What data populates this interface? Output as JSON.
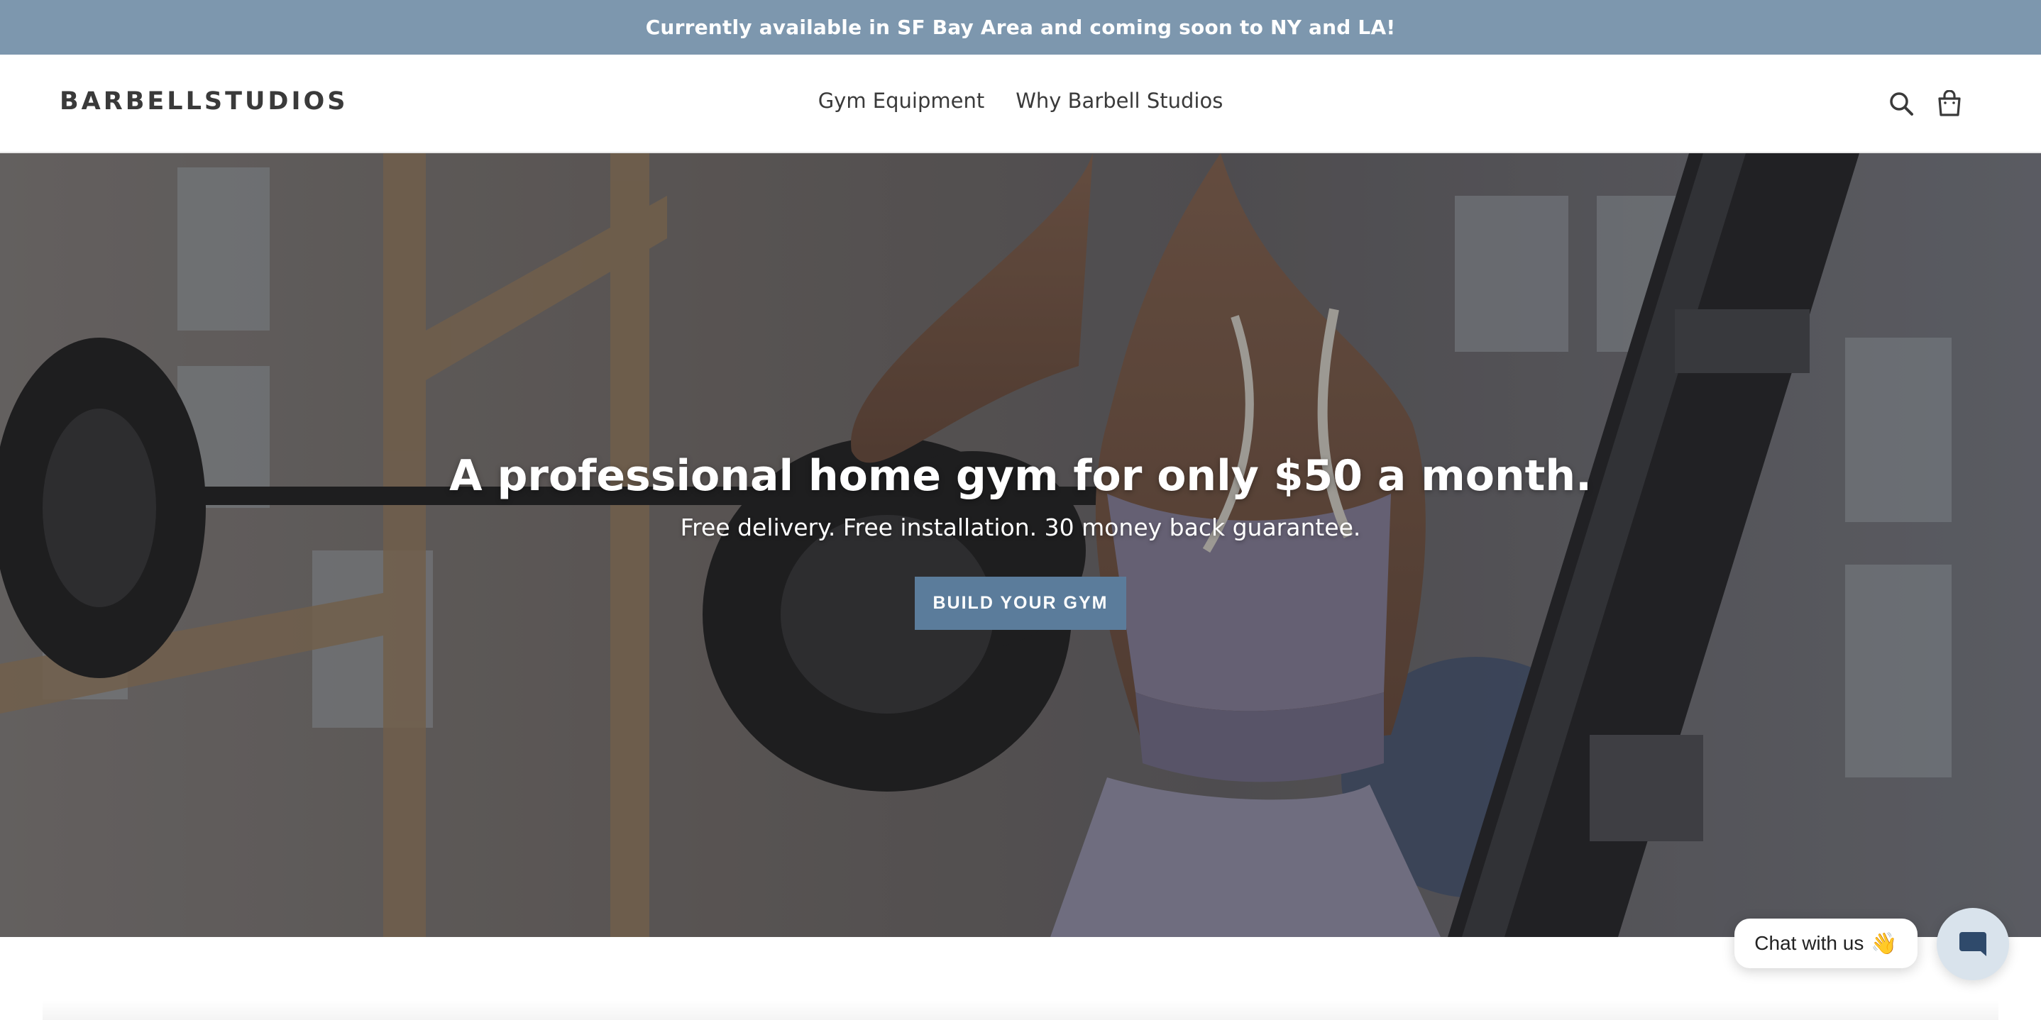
{
  "announcement": {
    "text": "Currently available in SF Bay Area and coming soon to NY and LA!"
  },
  "header": {
    "logo": "BARBELLSTUDIOS",
    "nav": [
      {
        "label": "Gym Equipment"
      },
      {
        "label": "Why Barbell Studios"
      }
    ],
    "icons": [
      "search-icon",
      "cart-icon"
    ]
  },
  "hero": {
    "title": "A professional home gym for only $50 a month.",
    "subtitle": "Free delivery. Free installation. 30 money back guarantee.",
    "cta_label": "BUILD YOUR GYM"
  },
  "chat": {
    "label": "Chat with us",
    "emoji": "👋",
    "icon": "chat-bubble-icon"
  },
  "colors": {
    "announcement_bg": "#7d97ae",
    "cta_bg": "#5b7c9b",
    "text_dark": "#3a3a3a"
  }
}
